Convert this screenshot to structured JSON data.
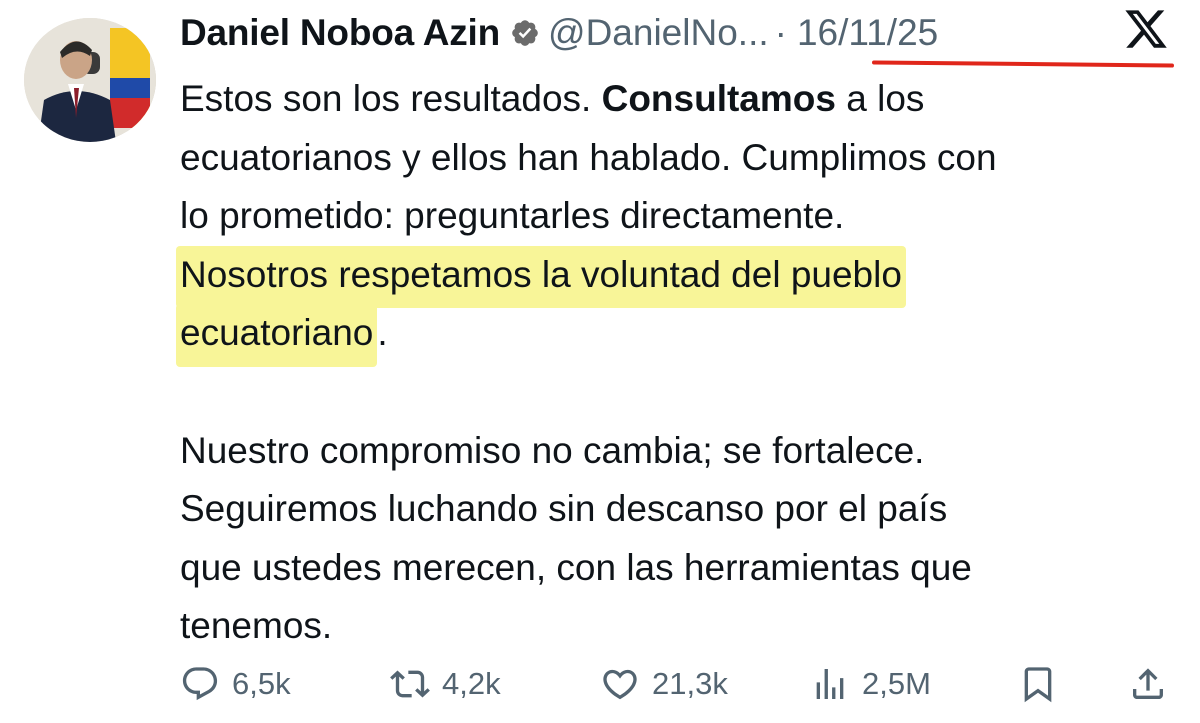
{
  "tweet": {
    "display_name": "Daniel Noboa Azin",
    "handle": "@DanielNo...",
    "separator": "·",
    "date": "16/11/25",
    "lines": [
      {
        "pre": "Estos son los resultados. ",
        "bold": "Consultamos",
        "post": " a los"
      },
      {
        "text": "ecuatorianos y ellos han hablado. Cumplimos con"
      },
      {
        "text": "lo prometido: preguntarles directamente."
      },
      {
        "highlight": "Nosotros respetamos la voluntad del pueblo"
      },
      {
        "highlight": "ecuatoriano",
        "post": "."
      },
      {
        "text": ""
      },
      {
        "text": "Nuestro compromiso no cambia; se fortalece."
      },
      {
        "text": "Seguiremos luchando sin descanso por el país"
      },
      {
        "text": "que ustedes merecen, con las herramientas que"
      },
      {
        "text": "tenemos."
      }
    ]
  },
  "metrics": {
    "replies": "6,5k",
    "reposts": "4,2k",
    "likes": "21,3k",
    "views": "2,5M"
  },
  "colors": {
    "highlight": "#f8f598",
    "annotation_underline": "#e0261b",
    "verified_badge": "#6b6b6b",
    "muted_text": "#536471"
  },
  "icons": {
    "verified": "verified-badge-icon",
    "platform": "x-logo-icon",
    "reply": "reply-icon",
    "repost": "repost-icon",
    "like": "heart-icon",
    "views": "views-chart-icon",
    "bookmark": "bookmark-icon",
    "share": "share-icon"
  }
}
